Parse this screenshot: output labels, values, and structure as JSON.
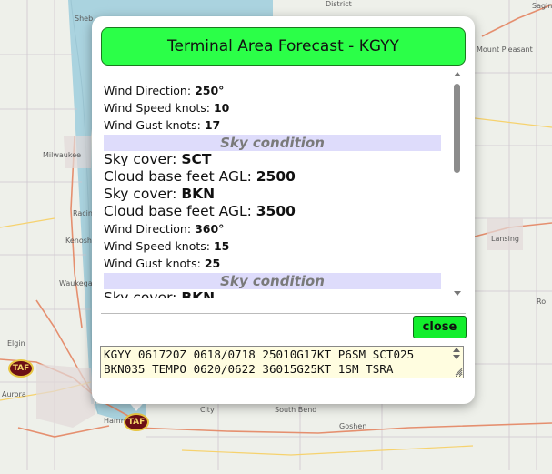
{
  "map": {
    "labels": {
      "sheboygan": "Sheb",
      "milwaukee": "Milwaukee",
      "racine": "Racin",
      "kenosha": "Kenosh",
      "waukegan": "Waukega",
      "elgin": "Elgin",
      "aurora": "Aurora",
      "hammond": "Hamm",
      "city": "City",
      "south_bend": "South Bend",
      "goshen": "Goshen",
      "mount_pleasant": "Mount Pleasant",
      "lansing": "Lansing",
      "saginaw": "Sagin",
      "district": "District",
      "ro": "Ro"
    },
    "markers": {
      "left": "TAF",
      "station": "TAF"
    }
  },
  "popup": {
    "title": "Terminal Area Forecast - KGYY",
    "groups": [
      {
        "wind_direction": {
          "label": "Wind Direction:",
          "value": "250°"
        },
        "wind_speed": {
          "label": "Wind Speed knots:",
          "value": "10"
        },
        "wind_gust": {
          "label": "Wind Gust knots:",
          "value": "17"
        },
        "sky_header": "Sky condition",
        "sky": [
          {
            "cover_label": "Sky cover:",
            "cover": "SCT",
            "base_label": "Cloud base feet AGL:",
            "base": "2500"
          },
          {
            "cover_label": "Sky cover:",
            "cover": "BKN",
            "base_label": "Cloud base feet AGL:",
            "base": "3500"
          }
        ]
      },
      {
        "wind_direction": {
          "label": "Wind Direction:",
          "value": "360°"
        },
        "wind_speed": {
          "label": "Wind Speed knots:",
          "value": "15"
        },
        "wind_gust": {
          "label": "Wind Gust knots:",
          "value": "25"
        },
        "sky_header": "Sky condition",
        "sky": [
          {
            "cover_label": "Sky cover:",
            "cover": "BKN"
          }
        ]
      }
    ],
    "close_label": "close",
    "raw_taf": "KGYY 061720Z 0618/0718 25010G17KT P6SM SCT025 BKN035 TEMPO 0620/0622 36015G25KT 1SM TSRA"
  },
  "colors": {
    "header_green": "#2bff48",
    "close_green": "#12ee2c",
    "sky_band": "#dedcfb",
    "raw_box": "#fffde0",
    "lake": "#aad3df",
    "marker": "#6b0f16"
  }
}
